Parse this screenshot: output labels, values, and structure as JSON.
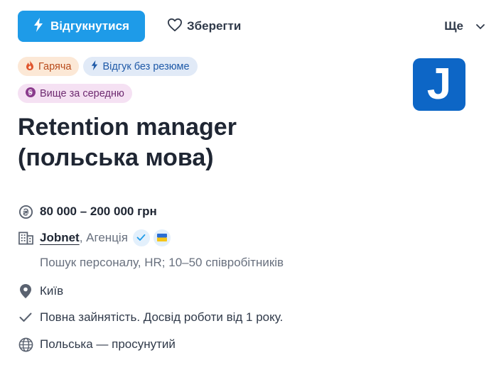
{
  "actions": {
    "apply_label": "Відгукнутися",
    "save_label": "Зберегти",
    "more_label": "Ще"
  },
  "badges": [
    {
      "label": "Гаряча",
      "icon": "fire-icon"
    },
    {
      "label": "Відгук без резюме",
      "icon": "bolt-icon"
    },
    {
      "label": "Вище за середню",
      "icon": "currency-icon"
    }
  ],
  "company_logo": {
    "letter": "J",
    "color": "#0d66c6"
  },
  "job": {
    "title_line1": "Retention manager",
    "title_line2": "(польська мова)"
  },
  "details": {
    "salary": "80 000 – 200 000 грн",
    "company_name": "Jobnet",
    "company_type": ", Агенція",
    "company_description": "Пошук персоналу, HR; 10–50 співробітників",
    "location": "Київ",
    "employment": "Повна зайнятість. Досвід роботи від 1 року.",
    "language": "Польська — просунутий"
  },
  "colors": {
    "primary": "#1e9be8",
    "text": "#303a4a",
    "muted": "#68707e"
  }
}
